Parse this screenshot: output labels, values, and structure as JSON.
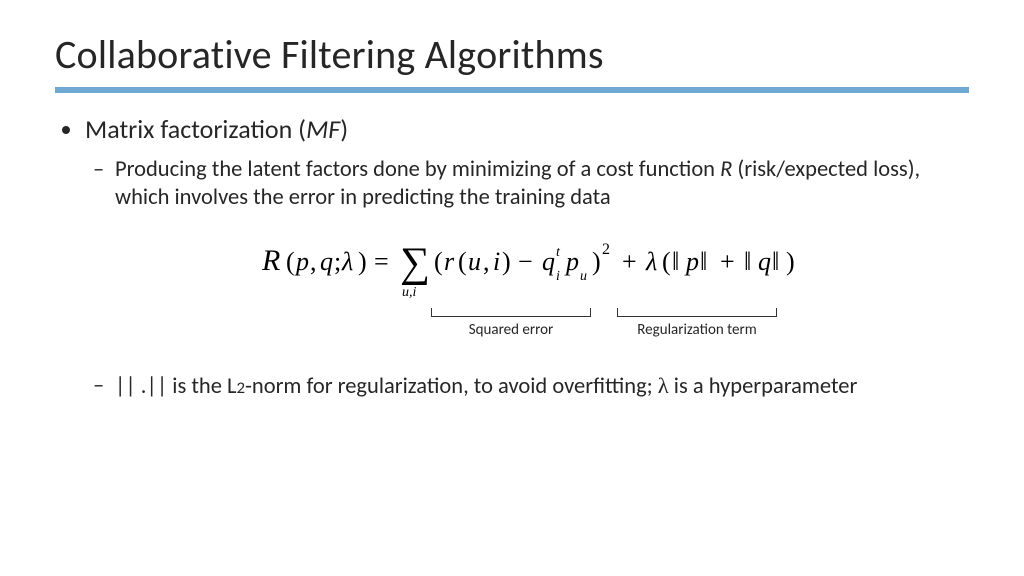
{
  "title": "Collaborative Filtering Algorithms",
  "bullets": {
    "mf_title_pre": "Matrix factorization (",
    "mf_title_ital": "MF",
    "mf_title_post": ")",
    "sub1_pre": "Producing the latent factors done by minimizing of a cost function ",
    "sub1_ital": "R",
    "sub1_post": " (risk/expected loss), which involves the error in predicting the training data",
    "sub2_pre": "|| .|| is the L",
    "sub2_two": "2",
    "sub2_mid": "-norm for regularization, to avoid overfitting; ",
    "sub2_lambda": "λ",
    "sub2_post": " is a hyperparameter"
  },
  "equation": {
    "annot1": "Squared  error",
    "annot2": "Regularization term"
  }
}
